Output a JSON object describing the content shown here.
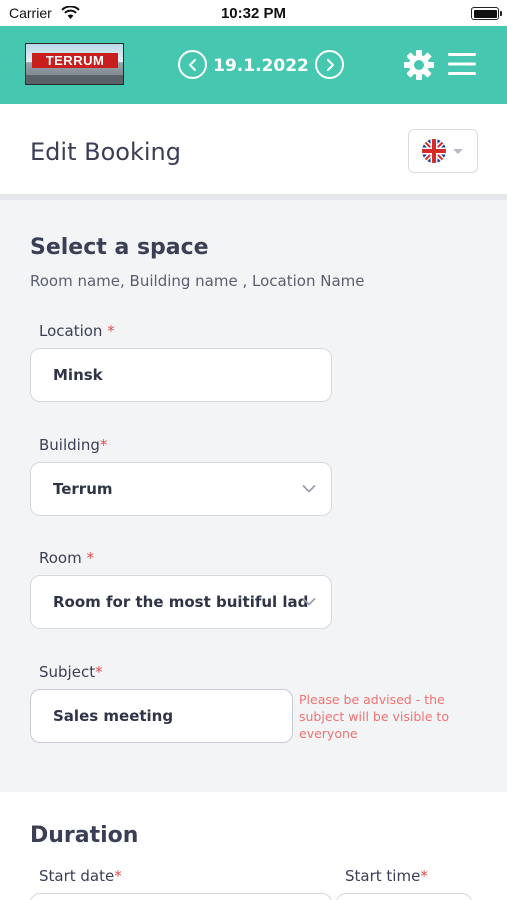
{
  "status_bar": {
    "carrier": "Carrier",
    "time": "10:32 PM"
  },
  "app_bar": {
    "logo_text": "TERRUM",
    "date": "19.1.2022",
    "accent_color": "#46c8b0"
  },
  "header": {
    "title": "Edit Booking",
    "language_flag": "uk-flag-icon"
  },
  "space_section": {
    "title": "Select a space",
    "subtitle": "Room name, Building name , Location Name"
  },
  "form": {
    "location": {
      "label": "Location",
      "required_mark": "*",
      "value": "Minsk"
    },
    "building": {
      "label": "Building",
      "required_mark": "*",
      "value": "Terrum"
    },
    "room": {
      "label": "Room",
      "required_mark": "*",
      "value": "Room for the most buitiful lad"
    },
    "subject": {
      "label": "Subject",
      "required_mark": "*",
      "value": "Sales meeting",
      "hint": "Please be advised - the subject will be visible to everyone"
    }
  },
  "duration_section": {
    "title": "Duration",
    "start_date": {
      "label": "Start date",
      "required_mark": "*"
    },
    "start_time": {
      "label": "Start time",
      "required_mark": "*"
    }
  }
}
